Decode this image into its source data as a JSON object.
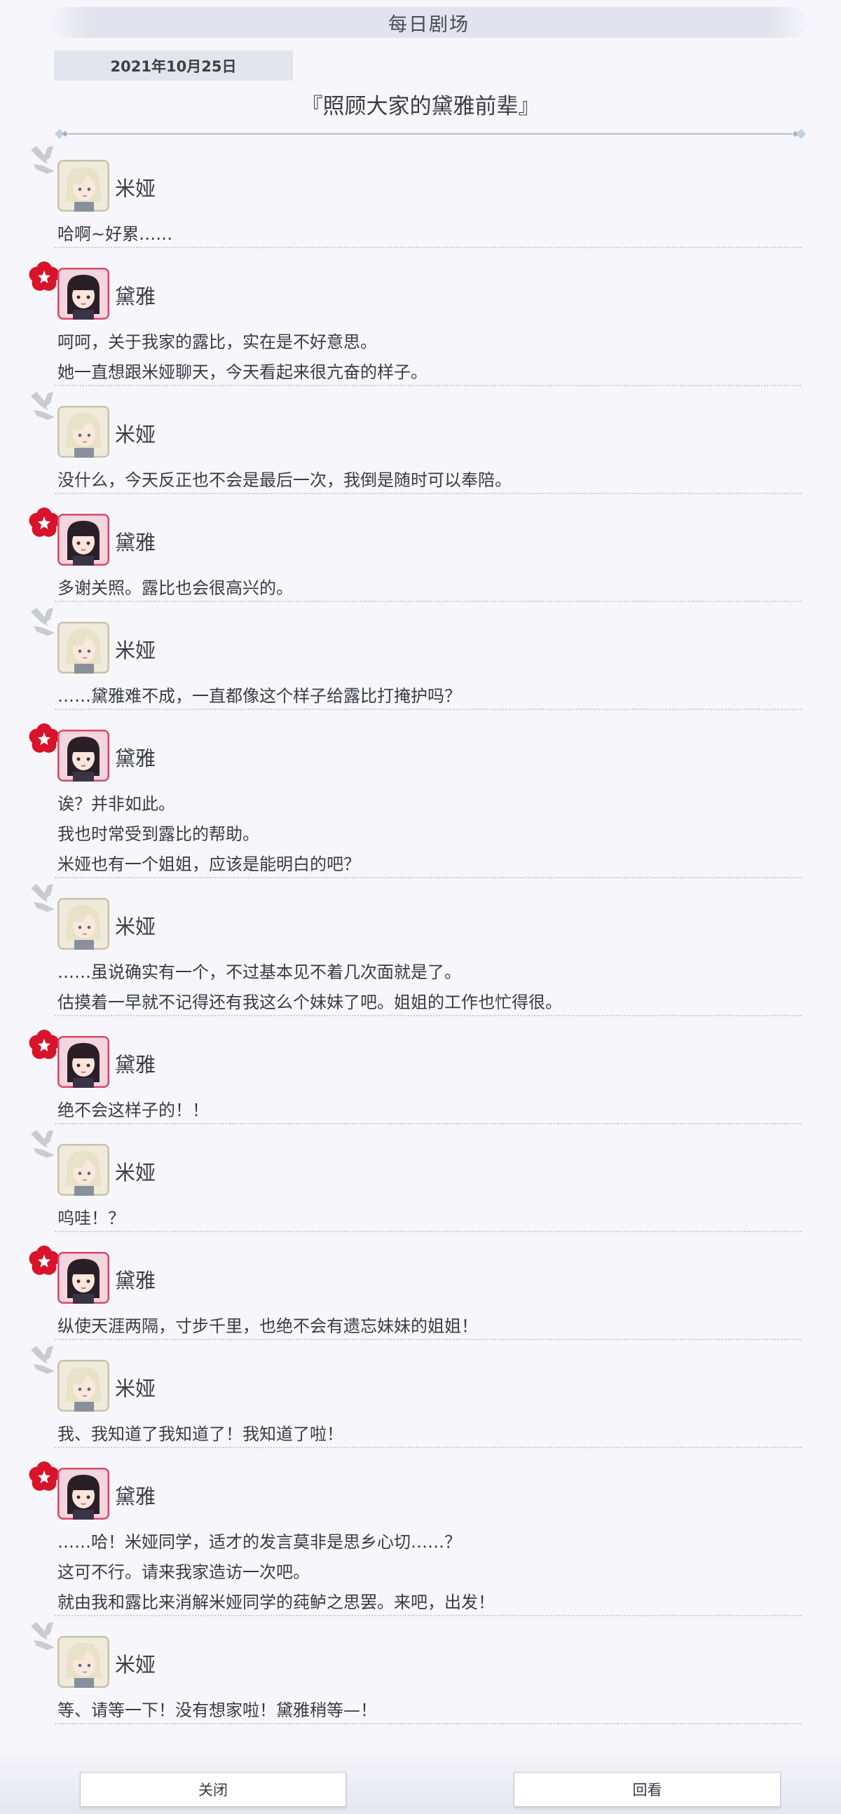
{
  "header": {
    "title": "每日剧场",
    "date": "2021年10月25日",
    "episode_title": "『照顾大家的黛雅前辈』"
  },
  "characters": {
    "mia": {
      "name": "米娅",
      "emblem_icon": "crossed-swords-emblem-icon",
      "emblem_color": "#c9cbd1",
      "avatar_bg": "#f0eadb"
    },
    "daiya": {
      "name": "黛雅",
      "emblem_icon": "red-flower-emblem-icon",
      "emblem_color": "#d8132b",
      "avatar_bg": "#f3d5de"
    }
  },
  "dialogue": [
    {
      "speaker": "米娅",
      "char": "mia",
      "lines": [
        "哈啊~好累……"
      ]
    },
    {
      "speaker": "黛雅",
      "char": "daiya",
      "lines": [
        "呵呵，关于我家的露比，实在是不好意思。",
        "她一直想跟米娅聊天，今天看起来很亢奋的样子。"
      ]
    },
    {
      "speaker": "米娅",
      "char": "mia",
      "lines": [
        "没什么，今天反正也不会是最后一次，我倒是随时可以奉陪。"
      ]
    },
    {
      "speaker": "黛雅",
      "char": "daiya",
      "lines": [
        "多谢关照。露比也会很高兴的。"
      ]
    },
    {
      "speaker": "米娅",
      "char": "mia",
      "lines": [
        "……黛雅难不成，一直都像这个样子给露比打掩护吗？"
      ]
    },
    {
      "speaker": "黛雅",
      "char": "daiya",
      "lines": [
        "诶？并非如此。",
        "我也时常受到露比的帮助。",
        "米娅也有一个姐姐，应该是能明白的吧？"
      ]
    },
    {
      "speaker": "米娅",
      "char": "mia",
      "lines": [
        "……虽说确实有一个，不过基本见不着几次面就是了。",
        "估摸着一早就不记得还有我这么个妹妹了吧。姐姐的工作也忙得很。"
      ]
    },
    {
      "speaker": "黛雅",
      "char": "daiya",
      "lines": [
        "绝不会这样子的！！"
      ]
    },
    {
      "speaker": "米娅",
      "char": "mia",
      "lines": [
        "呜哇！？"
      ]
    },
    {
      "speaker": "黛雅",
      "char": "daiya",
      "lines": [
        "纵使天涯两隔，寸步千里，也绝不会有遗忘妹妹的姐姐！"
      ]
    },
    {
      "speaker": "米娅",
      "char": "mia",
      "lines": [
        "我、我知道了我知道了！我知道了啦！"
      ]
    },
    {
      "speaker": "黛雅",
      "char": "daiya",
      "lines": [
        "……哈！米娅同学，适才的发言莫非是思乡心切……？",
        "这可不行。请来我家造访一次吧。",
        "就由我和露比来消解米娅同学的莼鲈之思罢。来吧，出发！"
      ]
    },
    {
      "speaker": "米娅",
      "char": "mia",
      "lines": [
        "等、请等一下！没有想家啦！黛雅稍等—！"
      ]
    }
  ],
  "footer": {
    "close_label": "关闭",
    "replay_label": "回看"
  }
}
